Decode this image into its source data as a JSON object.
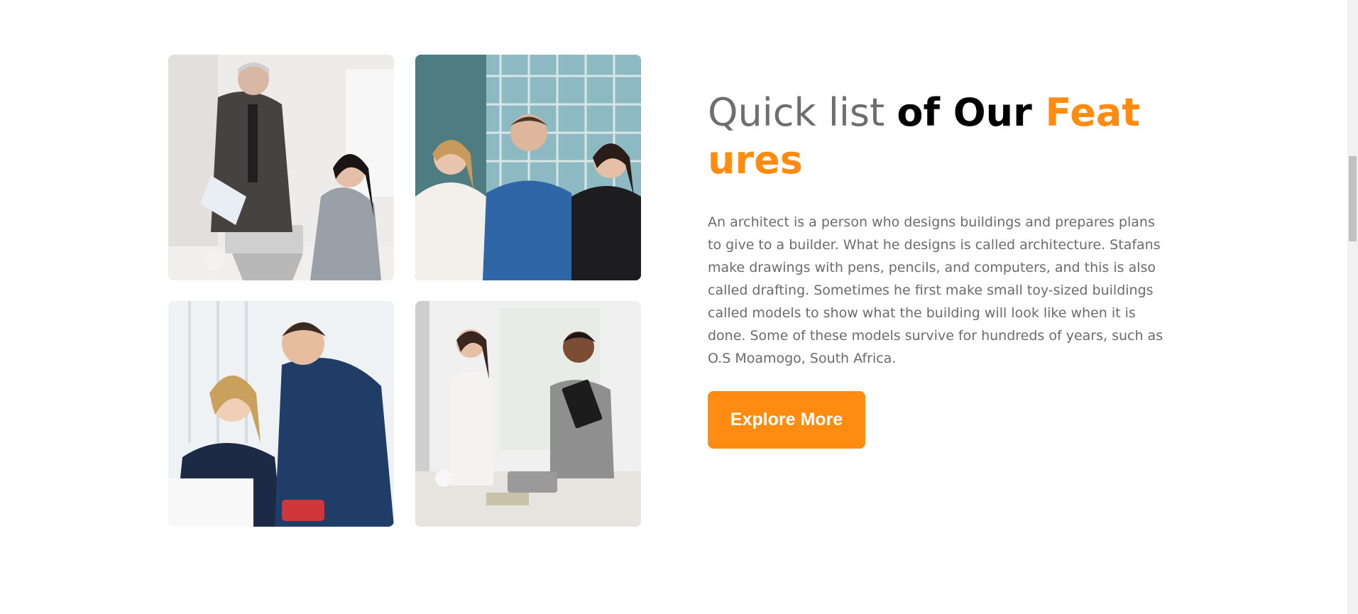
{
  "features": {
    "heading": {
      "part_light": "Quick list ",
      "part_dark": "of Our ",
      "part_accent": "Features"
    },
    "description": "An architect is a person who designs buildings and prepares plans to give to a builder. What he designs is called architecture. Stafans make drawings with pens, pencils, and computers, and this is also called drafting. Sometimes he first make small toy-sized buildings called models to show what the building will look like when it is done. Some of these models survive for hundreds of years, such as O.S Moamogo, South Africa.",
    "button_label": "Explore More",
    "accent_color": "#ff8c10"
  },
  "gallery": [
    {
      "subject": "office-meeting-photo"
    },
    {
      "subject": "business-team-photo"
    },
    {
      "subject": "coworkers-laptop-photo"
    },
    {
      "subject": "handshake-photo"
    }
  ]
}
